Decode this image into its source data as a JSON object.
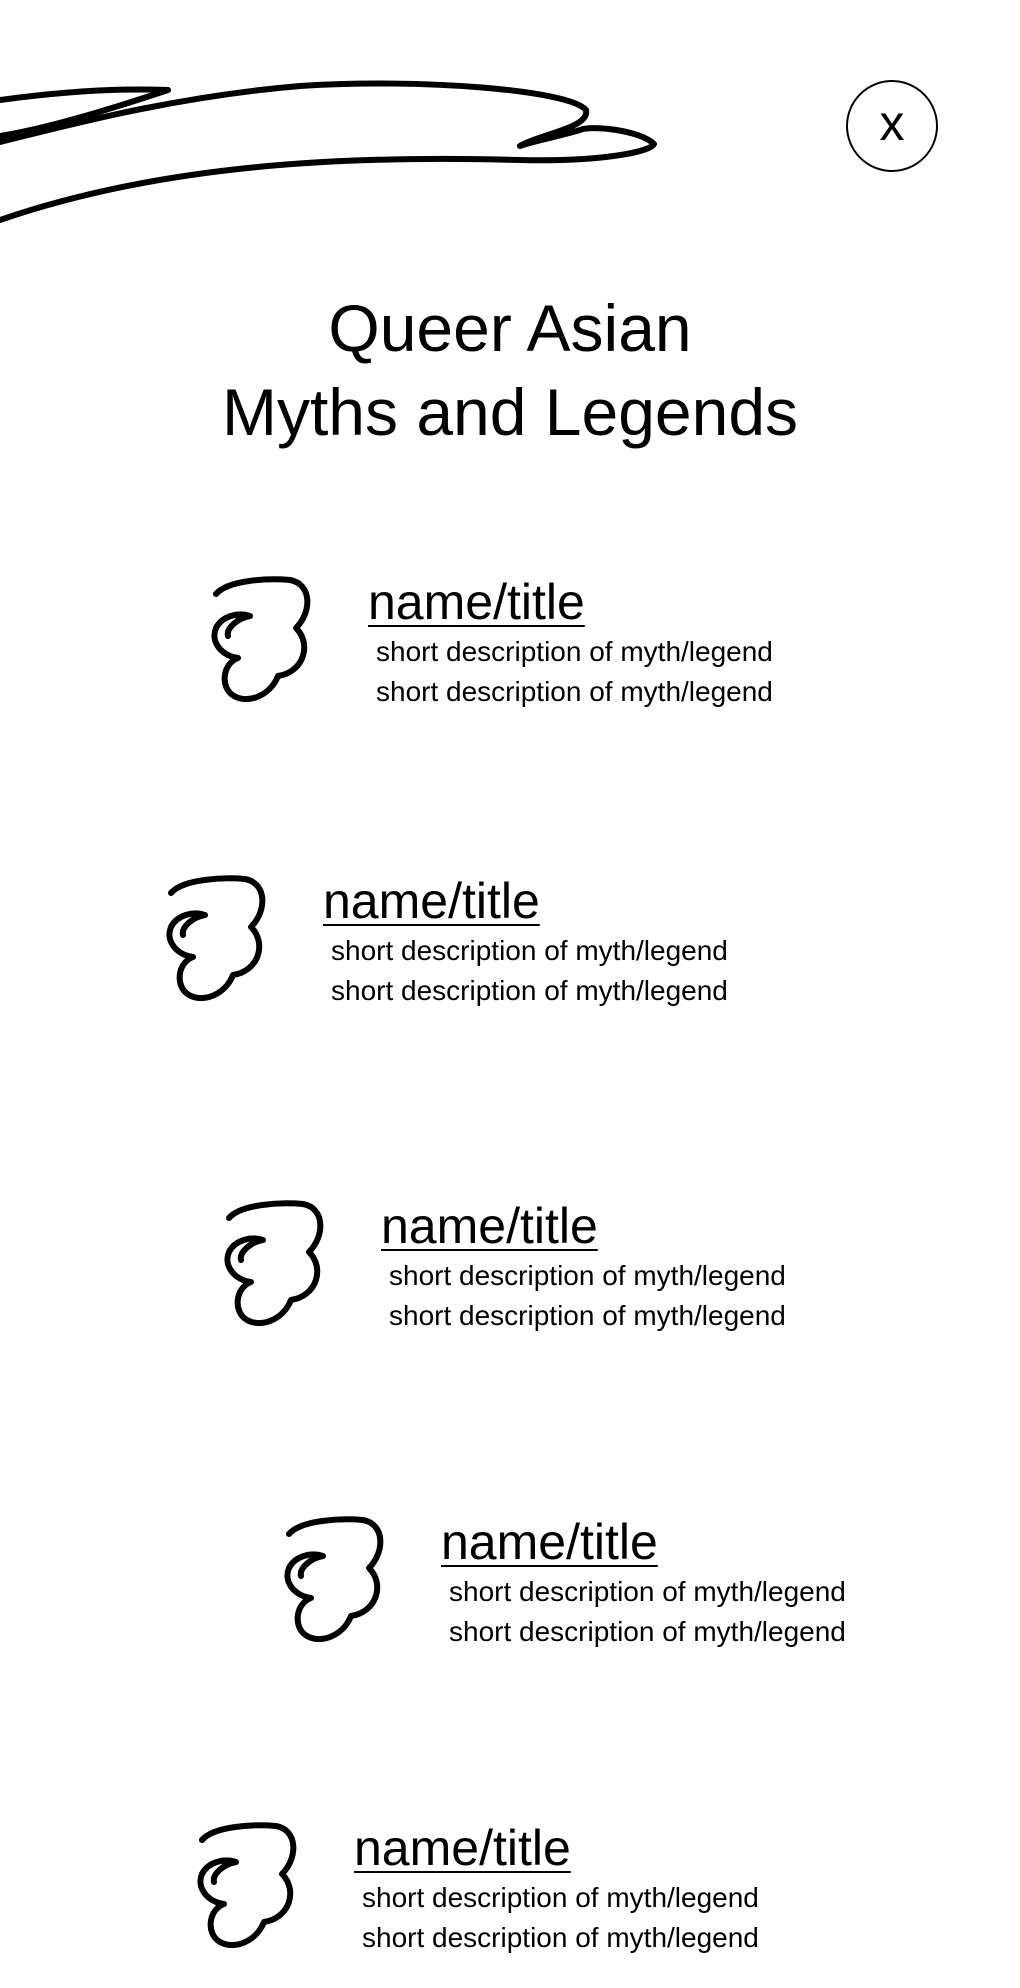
{
  "close_button": {
    "label": "x"
  },
  "title": {
    "line1": "Queer Asian",
    "line2": "Myths and Legends"
  },
  "entries": [
    {
      "title": "name/title",
      "desc1": "short description of myth/legend",
      "desc2": "short description of myth/legend",
      "icon": "curly-doodle-icon"
    },
    {
      "title": "name/title",
      "desc1": "short description of myth/legend",
      "desc2": "short description of myth/legend",
      "icon": "curly-doodle-icon"
    },
    {
      "title": "name/title",
      "desc1": "short description of myth/legend",
      "desc2": "short description of myth/legend",
      "icon": "curly-doodle-icon"
    },
    {
      "title": "name/title",
      "desc1": "short description of myth/legend",
      "desc2": "short description of myth/legend",
      "icon": "curly-doodle-icon"
    },
    {
      "title": "name/title",
      "desc1": "short description of myth/legend",
      "desc2": "short description of myth/legend",
      "icon": "curly-doodle-icon"
    }
  ],
  "colors": {
    "ink": "#000000",
    "background": "#ffffff"
  }
}
